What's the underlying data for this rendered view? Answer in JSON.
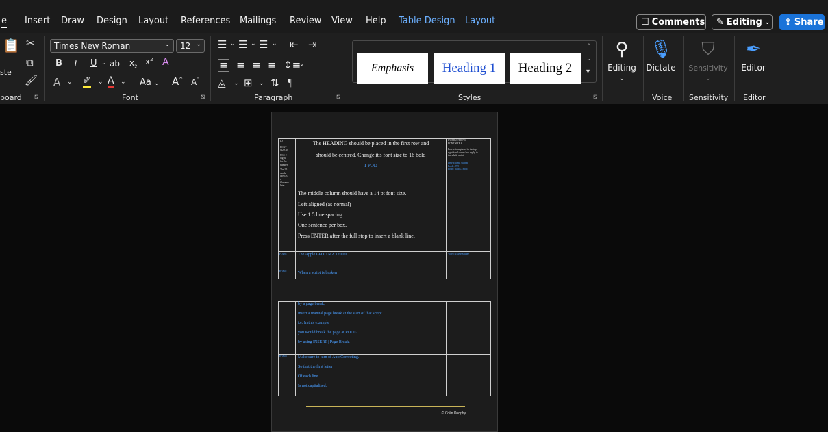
{
  "tabs": {
    "items": [
      "e",
      "Insert",
      "Draw",
      "Design",
      "Layout",
      "References",
      "Mailings",
      "Review",
      "View",
      "Help",
      "Table Design",
      "Layout"
    ],
    "comments": "Comments",
    "editing": "Editing",
    "share": "Share"
  },
  "clipboard": {
    "paste": "ste",
    "label": "board"
  },
  "font": {
    "name": "Times New Roman",
    "size": "12",
    "label": "Font",
    "bold": "B",
    "italic": "I",
    "underline": "U",
    "strike": "ab",
    "sub": "x",
    "sup": "x",
    "case": "Aa",
    "grow": "A",
    "shrink": "A"
  },
  "paragraph": {
    "label": "Paragraph",
    "pilcrow": "¶"
  },
  "styles": {
    "label": "Styles",
    "items": [
      "Emphasis",
      "Heading 1",
      "Heading 2"
    ]
  },
  "groups": {
    "editing": "Editing",
    "dictate": "Dictate",
    "voice": "Voice",
    "sensitivity": "Sensitivity",
    "editor": "Editor"
  },
  "doc": {
    "left_col": [
      "ID",
      "FONT",
      "SIZE 10",
      "USE 2",
      "digits",
      "for the",
      "number",
      "The ID",
      "can be",
      "used as",
      "a",
      "filename",
      "later"
    ],
    "heading_lines": [
      "The HEADING should be placed in the first row and",
      "should be centred. Change it's font size to 16 bold"
    ],
    "ipod": "I-POD",
    "body_lines": [
      "The middle column should have a 14 pt font size.",
      "Left aligned (as normal)",
      "Use 1.5 line spacing.",
      "One sentence per box.",
      "Press ENTER after the full stop to insert a blank line."
    ],
    "right_col": {
      "title": "INSTRUCTIONS",
      "font": "FONT SIZE 8",
      "lines": [
        "Instructions placed in the top",
        "right hand corner box apply to",
        "the whole script."
      ],
      "blue": [
        "Instructions: All text",
        "Inside: 999",
        "Fonts: Italics / Bold"
      ]
    },
    "row2": {
      "id": "POD01",
      "text": "The Apple I-POD MZ 1200 is...",
      "note": "Video: Title/Headline"
    },
    "row3": {
      "id": "POD01",
      "text": "When a script is broken"
    },
    "table2": {
      "lines": [
        "by a page break,",
        "insert a manual page break at the start of that script",
        "i.e. In this example",
        "you would break the page at POD02",
        "by using INSERT | Page Break."
      ],
      "id": "POD03",
      "lines2": [
        "Make sure to turn of AutoCorrecting.",
        "So that the first letter",
        "Of each line",
        "Is not capitalised."
      ]
    },
    "footer": "© Colm Dunphy"
  },
  "colors": {
    "accent": "#1a73d9",
    "link": "#4a9eff",
    "ribbon": "#1f1f1f",
    "tabs": "#1b1b1b"
  }
}
